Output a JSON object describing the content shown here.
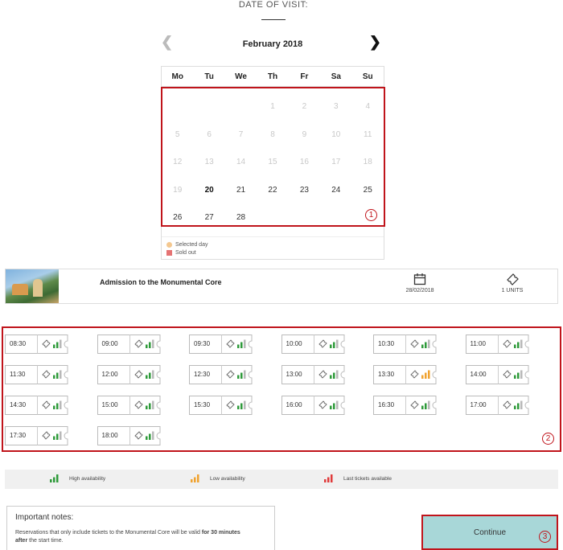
{
  "header": {
    "title": "DATE OF VISIT:"
  },
  "calendar": {
    "month_label": "February 2018",
    "weekdays": [
      "Mo",
      "Tu",
      "We",
      "Th",
      "Fr",
      "Sa",
      "Su"
    ],
    "days": [
      [
        "",
        "",
        "",
        "1",
        "2",
        "3",
        "4"
      ],
      [
        "5",
        "6",
        "7",
        "8",
        "9",
        "10",
        "11"
      ],
      [
        "12",
        "13",
        "14",
        "15",
        "16",
        "17",
        "18"
      ],
      [
        "19",
        "20",
        "21",
        "22",
        "23",
        "24",
        "25"
      ],
      [
        "26",
        "27",
        "28",
        "",
        "",
        "",
        ""
      ]
    ],
    "first_available_day": 20,
    "selected_day": 20,
    "legend": {
      "selected": "Selected day",
      "sold_out": "Sold out"
    },
    "colors": {
      "selected": "#f4c890",
      "sold_out": "#e57373"
    }
  },
  "annotations": {
    "badge1": "1",
    "badge2": "2",
    "badge3": "3"
  },
  "product": {
    "name": "Admission to the Monumental Core",
    "date": "28/02/2018",
    "units": "1 UNITS"
  },
  "time_slots": [
    {
      "time": "08:30",
      "availability": "high"
    },
    {
      "time": "09:00",
      "availability": "high"
    },
    {
      "time": "09:30",
      "availability": "high"
    },
    {
      "time": "10:00",
      "availability": "high"
    },
    {
      "time": "10:30",
      "availability": "high"
    },
    {
      "time": "11:00",
      "availability": "high"
    },
    {
      "time": "11:30",
      "availability": "high"
    },
    {
      "time": "12:00",
      "availability": "high"
    },
    {
      "time": "12:30",
      "availability": "high"
    },
    {
      "time": "13:00",
      "availability": "high"
    },
    {
      "time": "13:30",
      "availability": "low"
    },
    {
      "time": "14:00",
      "availability": "high"
    },
    {
      "time": "14:30",
      "availability": "high"
    },
    {
      "time": "15:00",
      "availability": "high"
    },
    {
      "time": "15:30",
      "availability": "high"
    },
    {
      "time": "16:00",
      "availability": "high"
    },
    {
      "time": "16:30",
      "availability": "high"
    },
    {
      "time": "17:00",
      "availability": "high"
    },
    {
      "time": "17:30",
      "availability": "high"
    },
    {
      "time": "18:00",
      "availability": "high"
    }
  ],
  "availability_legend": {
    "high": "High availability",
    "low": "Low availability",
    "last": "Last tickets available"
  },
  "availability_colors": {
    "high": "#2e9a3a",
    "low": "#f0a22e",
    "last": "#e03a3a",
    "off": "#b8b8b8"
  },
  "notes": {
    "title": "Important notes:",
    "text_pre": "Reservations that only include tickets to the Monumental Core will be valid ",
    "text_bold1": "for 30 minutes",
    "text_bold2": "after",
    "text_post": " the start time."
  },
  "continue_label": "Continue"
}
